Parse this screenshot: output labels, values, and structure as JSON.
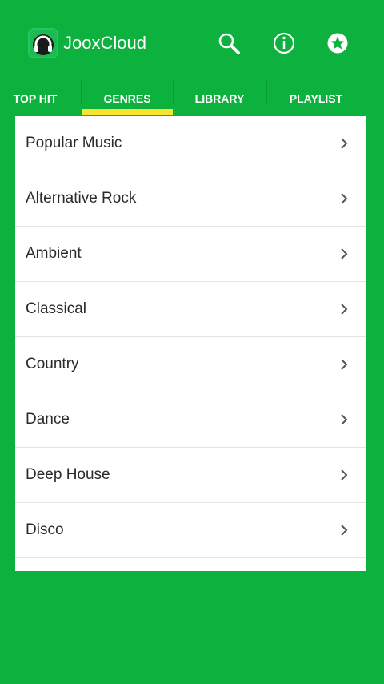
{
  "app": {
    "title": "JooxCloud",
    "brand_color": "#0db23e",
    "indicator_color": "#f6e52f"
  },
  "actions": [
    {
      "icon": "search-icon"
    },
    {
      "icon": "info-icon"
    },
    {
      "icon": "star-icon"
    }
  ],
  "tabs": [
    {
      "label": "TOP HIT",
      "selected": false
    },
    {
      "label": "GENRES",
      "selected": true
    },
    {
      "label": "LIBRARY",
      "selected": false
    },
    {
      "label": "PLAYLIST",
      "selected": false
    }
  ],
  "genres": [
    {
      "label": "Popular Music"
    },
    {
      "label": "Alternative Rock"
    },
    {
      "label": "Ambient"
    },
    {
      "label": "Classical"
    },
    {
      "label": "Country"
    },
    {
      "label": "Dance"
    },
    {
      "label": "Deep House"
    },
    {
      "label": "Disco"
    }
  ]
}
